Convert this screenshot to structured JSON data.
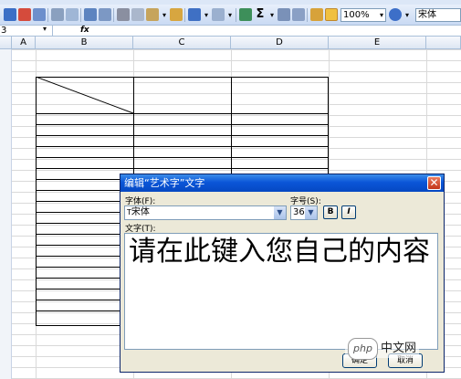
{
  "toolbar": {
    "zoom": "100%",
    "font_name": "宋体"
  },
  "formula_bar": {
    "name_box": "3",
    "fx_label": "fx"
  },
  "sheet": {
    "columns": [
      "A",
      "B",
      "C",
      "D",
      "E"
    ]
  },
  "dialog": {
    "title": "编辑“艺术字”文字",
    "font_label": "字体(F):",
    "size_label": "字号(S):",
    "font_value": "宋体",
    "size_value": "36",
    "bold_label": "B",
    "italic_label": "I",
    "text_label": "文字(T):",
    "text_value": "请在此键入您自己的内容",
    "ok_label": "确定",
    "cancel_label": "取消"
  },
  "watermark": {
    "logo": "php",
    "text": "中文网"
  },
  "colors": {
    "titlebar": "#0b56d8",
    "dialog_bg": "#ece9d8",
    "close": "#c3361a"
  }
}
